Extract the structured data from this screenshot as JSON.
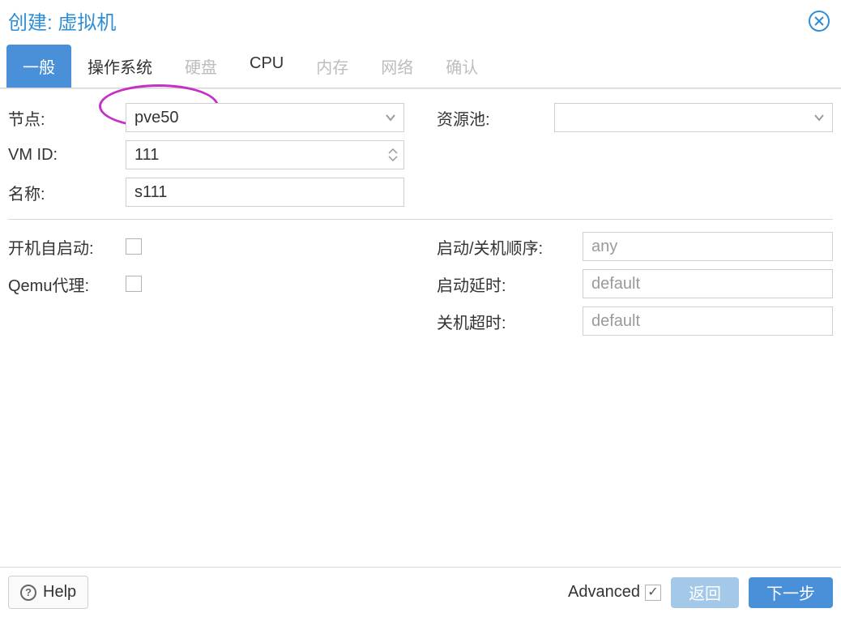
{
  "header": {
    "title": "创建: 虚拟机"
  },
  "tabs": [
    {
      "label": "一般",
      "state": "active"
    },
    {
      "label": "操作系统",
      "state": "enabled"
    },
    {
      "label": "硬盘",
      "state": "disabled"
    },
    {
      "label": "CPU",
      "state": "enabled"
    },
    {
      "label": "内存",
      "state": "disabled"
    },
    {
      "label": "网络",
      "state": "disabled"
    },
    {
      "label": "确认",
      "state": "disabled"
    }
  ],
  "form": {
    "node": {
      "label": "节点:",
      "value": "pve50"
    },
    "vmid": {
      "label": "VM ID:",
      "value": "111"
    },
    "name": {
      "label": "名称:",
      "value": "s111"
    },
    "pool": {
      "label": "资源池:",
      "value": ""
    },
    "autostart": {
      "label": "开机自启动:",
      "checked": false
    },
    "qemu_agent": {
      "label": "Qemu代理:",
      "checked": false
    },
    "boot_order": {
      "label": "启动/关机顺序:",
      "placeholder": "any"
    },
    "boot_delay": {
      "label": "启动延时:",
      "placeholder": "default"
    },
    "shutdown_to": {
      "label": "关机超时:",
      "placeholder": "default"
    }
  },
  "footer": {
    "help": "Help",
    "advanced": {
      "label": "Advanced",
      "checked": true
    },
    "back": "返回",
    "next": "下一步"
  }
}
